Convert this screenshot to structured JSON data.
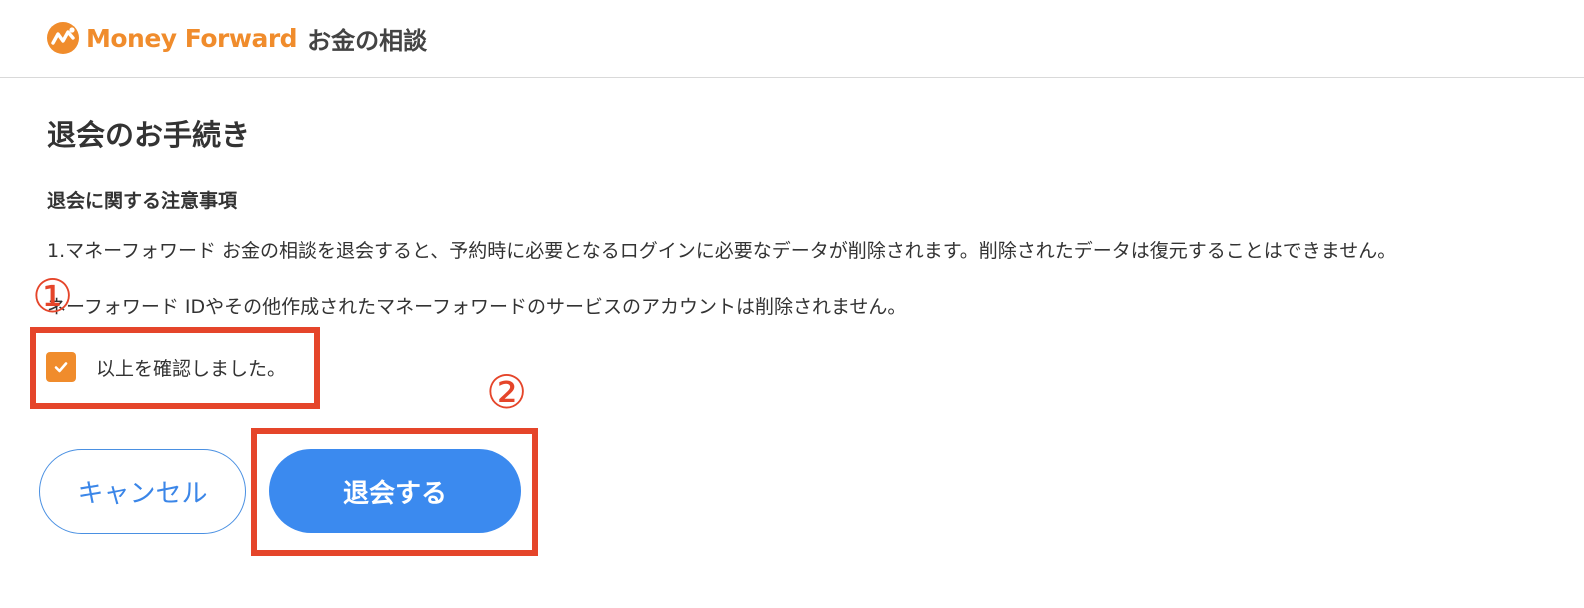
{
  "header": {
    "brand": "Money Forward",
    "service": "お金の相談",
    "brand_color": "#f08c2c",
    "logo_icon": "money-forward-logo-icon"
  },
  "main": {
    "page_title": "退会のお手続き",
    "section_title": "退会に関する注意事項",
    "notice_1": "1.マネーフォワード お金の相談を退会すると、予約時に必要となるログインに必要なデータが削除されます。削除されたデータは復元することはできません。",
    "notice_2": "ネーフォワード IDやその他作成されたマネーフォワードのサービスのアカウントは削除されません。",
    "confirm": {
      "label": "以上を確認しました。",
      "checked": true,
      "icon": "check-icon"
    },
    "buttons": {
      "cancel": "キャンセル",
      "withdraw": "退会する"
    }
  },
  "annotations": {
    "marker_1": "①",
    "marker_2": "②",
    "highlight_color": "#e5452a"
  },
  "colors": {
    "primary_blue": "#3b8aef",
    "checkbox_orange": "#f08c2c",
    "text": "#333333"
  }
}
